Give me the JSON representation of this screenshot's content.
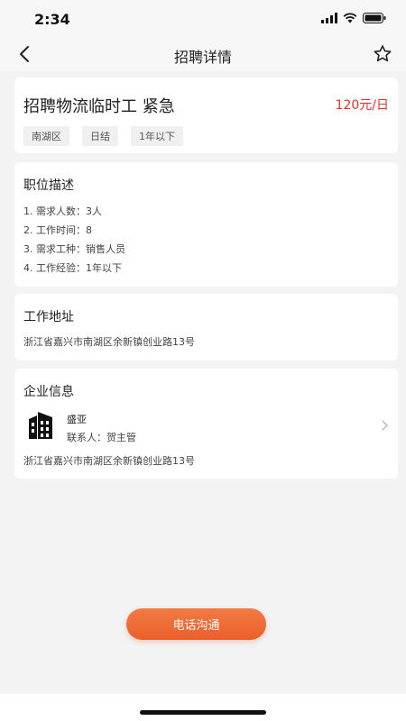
{
  "status": {
    "time": "2:34"
  },
  "nav": {
    "title": "招聘详情"
  },
  "job": {
    "title": "招聘物流临时工 紧急",
    "salary": "120元/日",
    "tags": [
      "南湖区",
      "日结",
      "1年以下"
    ]
  },
  "description": {
    "title": "职位描述",
    "items": [
      "1. 需求人数：3人",
      "2. 工作时间：8",
      "3. 需求工种：销售人员",
      "4. 工作经验：1年以下"
    ]
  },
  "address": {
    "title": "工作地址",
    "text": "浙江省嘉兴市南湖区余新镇创业路13号"
  },
  "company": {
    "title": "企业信息",
    "name": "盛亚",
    "contact": "联系人：贺主管",
    "address": "浙江省嘉兴市南湖区余新镇创业路13号"
  },
  "action": {
    "call_label": "电话沟通"
  },
  "colors": {
    "accent": "#ea5f2a",
    "salary": "#e0302a"
  }
}
